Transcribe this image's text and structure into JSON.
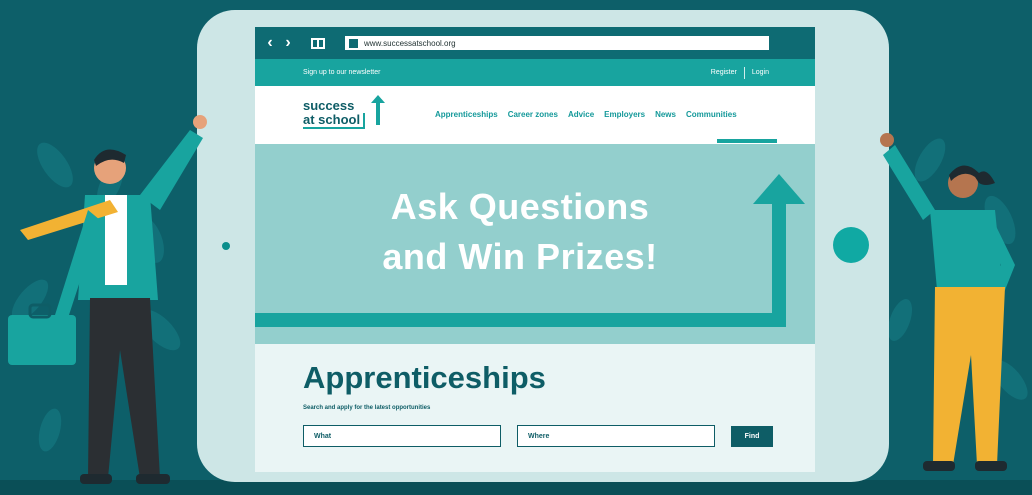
{
  "browser": {
    "url": "www.successatschool.org"
  },
  "top_strip": {
    "newsletter_link": "Sign up to our newsletter",
    "register_link": "Register",
    "login_link": "Login"
  },
  "header": {
    "logo_line1": "success",
    "logo_line2": "at school",
    "nav": [
      "Apprenticeships",
      "Career zones",
      "Advice",
      "Employers",
      "News",
      "Communities"
    ]
  },
  "hero": {
    "title_line1": "Ask Questions",
    "title_line2": "and Win Prizes!"
  },
  "search": {
    "title": "Apprenticeships",
    "subtitle": "Search and apply for the latest opportunities",
    "what_placeholder": "What",
    "where_placeholder": "Where",
    "find_label": "Find"
  },
  "colors": {
    "background": "#0d5f69",
    "brand_teal": "#18a49f",
    "dark_teal": "#0e5d66",
    "hero_teal": "#93cfcd",
    "accent_yellow": "#f2b233"
  },
  "icons": [
    "back-arrow-icon",
    "forward-arrow-icon",
    "tabs-icon",
    "favicon-icon",
    "logo-arrow-icon",
    "hero-arrow-icon"
  ]
}
